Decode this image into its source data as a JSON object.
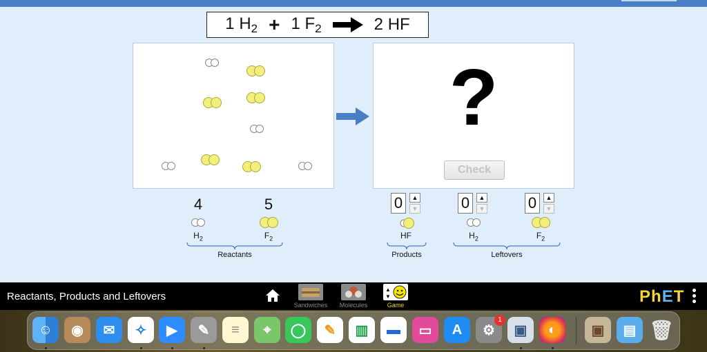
{
  "equation": {
    "reactant1_coef": "1",
    "reactant1_formula": "H",
    "reactant1_sub": "2",
    "plus": "+",
    "reactant2_coef": "1",
    "reactant2_formula": "F",
    "reactant2_sub": "2",
    "product_coef": "2",
    "product_formula": "HF"
  },
  "product_box": {
    "question": "?",
    "check_label": "Check"
  },
  "reactants": {
    "group_label": "Reactants",
    "items": [
      {
        "count": "4",
        "formula": "H",
        "sub": "2"
      },
      {
        "count": "5",
        "formula": "F",
        "sub": "2"
      }
    ]
  },
  "products": {
    "group_label": "Products",
    "items": [
      {
        "value": "0",
        "formula": "HF"
      }
    ]
  },
  "leftovers": {
    "group_label": "Leftovers",
    "items": [
      {
        "value": "0",
        "formula": "H",
        "sub": "2"
      },
      {
        "value": "0",
        "formula": "F",
        "sub": "2"
      }
    ]
  },
  "navbar": {
    "title": "Reactants, Products and Leftovers",
    "screens": [
      {
        "label": "Sandwiches",
        "active": false
      },
      {
        "label": "Molecules",
        "active": false
      },
      {
        "label": "Game",
        "active": true
      }
    ],
    "logo": {
      "p": "P",
      "h": "h",
      "e": "E",
      "t": "T"
    }
  },
  "dock": {
    "settings_badge": "1",
    "icons": [
      "finder-icon",
      "contacts-icon",
      "mail-icon",
      "safari-icon",
      "zoom-icon",
      "script-editor-icon",
      "notes-icon",
      "maps-icon",
      "messages-icon",
      "pages-icon",
      "numbers-icon",
      "keynote-icon",
      "screens-icon",
      "app-store-icon",
      "system-settings-icon",
      "preview-icon",
      "firefox-icon",
      "photo-folder-icon",
      "downloads-folder-icon",
      "trash-icon"
    ]
  },
  "colors": {
    "sim_bg": "#e0edfb",
    "h2": "#ffffff",
    "f2": "#f2f07a",
    "navbar_bg": "#000000",
    "arrow": "#4a7ec4"
  }
}
